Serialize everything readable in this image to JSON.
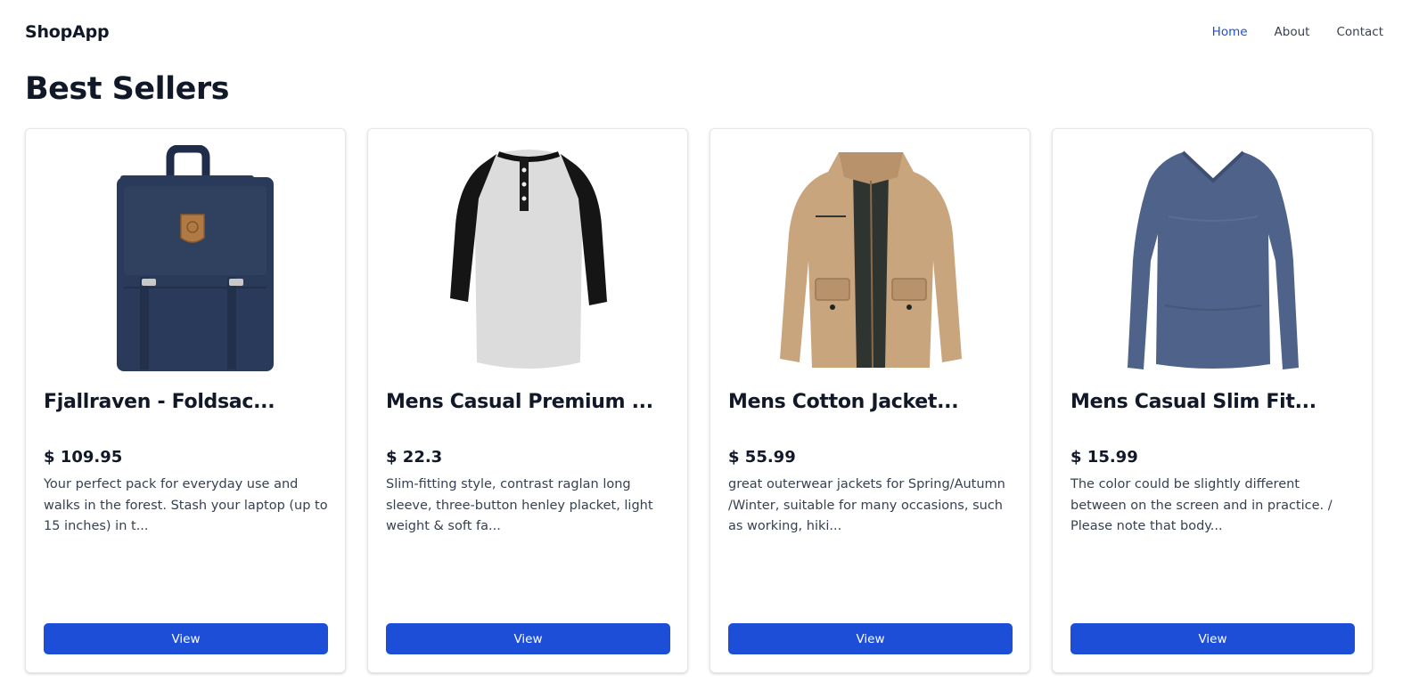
{
  "app": {
    "brand": "ShopApp",
    "nav": [
      "Home",
      "About",
      "Contact"
    ],
    "active_nav": "Home",
    "accent_color": "#1d4ed8"
  },
  "page": {
    "title": "Best Sellers"
  },
  "products": [
    {
      "image_icon": "navy-backpack-image",
      "title": "Fjallraven - Foldsac...",
      "price": "$ 109.95",
      "description": "Your perfect pack for everyday use and walks in the forest. Stash your laptop (up to 15 inches) in t...",
      "button_label": "View"
    },
    {
      "image_icon": "raglan-henley-shirt-image",
      "title": "Mens Casual Premium ...",
      "price": "$ 22.3",
      "description": "Slim-fitting style, contrast raglan long sleeve, three-button henley placket, light weight & soft fa...",
      "button_label": "View"
    },
    {
      "image_icon": "tan-cotton-jacket-image",
      "title": "Mens Cotton Jacket...",
      "price": "$ 55.99",
      "description": "great outerwear jackets for Spring/Autumn /Winter, suitable for many occasions, such as working, hiki...",
      "button_label": "View"
    },
    {
      "image_icon": "blue-long-sleeve-shirt-image",
      "title": "Mens Casual Slim Fit...",
      "price": "$ 15.99",
      "description": "The color could be slightly different between on the screen and in practice. / Please note that body...",
      "button_label": "View"
    }
  ]
}
